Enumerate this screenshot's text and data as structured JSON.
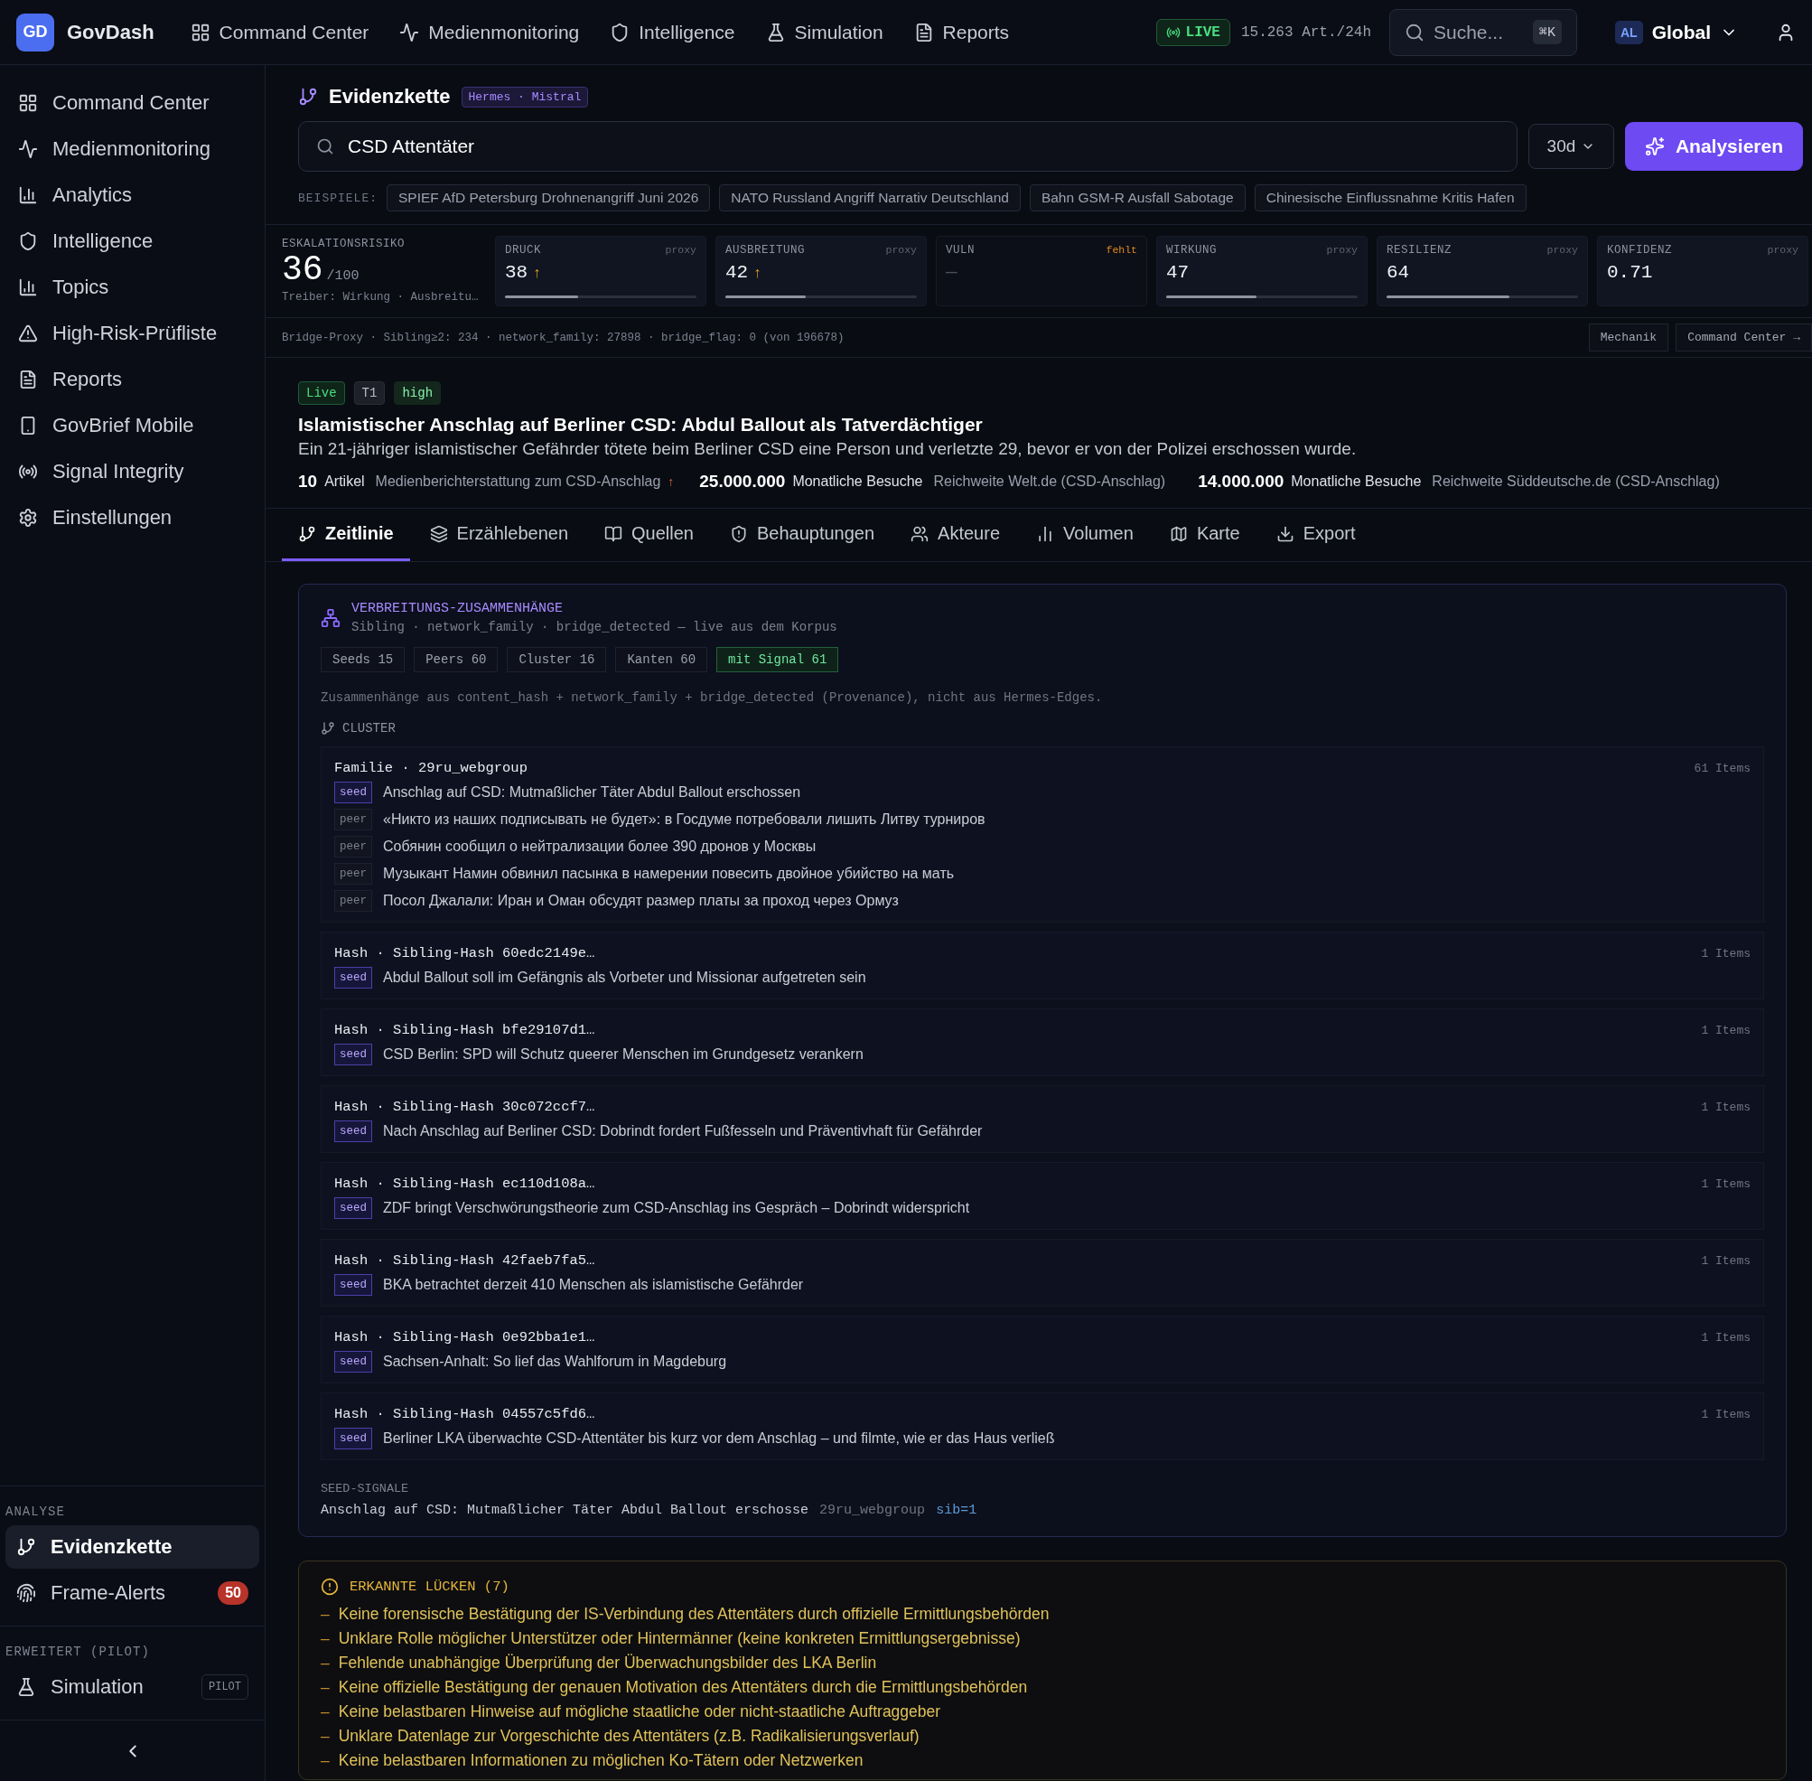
{
  "topbar": {
    "logo_badge": "GD",
    "logo_text": "GovDash",
    "nav": [
      {
        "label": "Command Center"
      },
      {
        "label": "Medienmonitoring"
      },
      {
        "label": "Intelligence"
      },
      {
        "label": "Simulation"
      },
      {
        "label": "Reports"
      }
    ],
    "live": "LIVE",
    "rate": "15.263 Art./24h",
    "search_placeholder": "Suche...",
    "search_shortcut": "⌘K",
    "scope_badge": "AL",
    "scope": "Global"
  },
  "sidebar": {
    "items": [
      {
        "label": "Command Center",
        "selected": false
      },
      {
        "label": "Medienmonitoring",
        "selected": false
      },
      {
        "label": "Analytics",
        "selected": false
      },
      {
        "label": "Intelligence",
        "selected": false
      },
      {
        "label": "Topics",
        "selected": false
      },
      {
        "label": "High-Risk-Prüfliste",
        "selected": false
      },
      {
        "label": "Reports",
        "selected": false
      },
      {
        "label": "GovBrief Mobile",
        "selected": false
      },
      {
        "label": "Signal Integrity",
        "selected": false
      },
      {
        "label": "Einstellungen",
        "selected": false
      }
    ],
    "sections": [
      {
        "title": "ANALYSE",
        "items": [
          {
            "label": "Evidenzkette",
            "selected": true
          },
          {
            "label": "Frame-Alerts",
            "selected": false,
            "badge": "50"
          }
        ]
      },
      {
        "title": "ERWEITERT (PILOT)",
        "items": [
          {
            "label": "Simulation",
            "selected": false,
            "tag": "PILOT"
          }
        ]
      }
    ]
  },
  "header": {
    "title": "Evidenzkette",
    "model_tag": "Hermes · Mistral",
    "query": "CSD Attentäter",
    "period": "30d",
    "analyze_button": "Analysieren",
    "examples_label": "BEISPIELE:",
    "examples": [
      "SPIEF AfD Petersburg Drohnenangriff Juni 2026",
      "NATO Russland Angriff Narrativ Deutschland",
      "Bahn GSM-R Ausfall Sabotage",
      "Chinesische Einflussnahme Kritis Hafen"
    ]
  },
  "escalation": {
    "label": "ESKALATIONSRISIKO",
    "value": "36",
    "scale": "/100",
    "drivers": "Treiber: Wirkung · Ausbreitu…"
  },
  "metrics": [
    {
      "label": "DRUCK",
      "tag": "proxy",
      "missing": false,
      "value": "38",
      "trend": "↑",
      "level": 0.38
    },
    {
      "label": "AUSBREITUNG",
      "tag": "proxy",
      "missing": false,
      "value": "42",
      "trend": "↑",
      "level": 0.42
    },
    {
      "label": "VULN",
      "tag": "fehlt",
      "missing": true,
      "value": "—"
    },
    {
      "label": "WIRKUNG",
      "tag": "proxy",
      "missing": false,
      "value": "47",
      "level": 0.47
    },
    {
      "label": "RESILIENZ",
      "tag": "proxy",
      "missing": false,
      "value": "64",
      "level": 0.64
    },
    {
      "label": "KONFIDENZ",
      "tag": "proxy",
      "missing": false,
      "value": "0.71"
    }
  ],
  "proxy_line": "Bridge-Proxy · Sibling≥2: 234 · network_family: 27898 · bridge_flag: 0 (von 196678)",
  "proxy_buttons": [
    "Mechanik",
    "Command Center →"
  ],
  "story": {
    "badges": [
      {
        "label": "Live",
        "kind": "live"
      },
      {
        "label": "T1",
        "kind": "tier"
      },
      {
        "label": "high",
        "kind": "level"
      }
    ],
    "title": "Islamistischer Anschlag auf Berliner CSD: Abdul Ballout als Tatverdächtiger",
    "summary": "Ein 21-jähriger islamistischer Gefährder tötete beim Berliner CSD eine Person und verletzte 29, bevor er von der Polizei erschossen wurde.",
    "stats": [
      {
        "value": "10",
        "unit": "Artikel",
        "desc": "Medienberichterstattung zum CSD-Anschlag",
        "trend": "↑"
      },
      {
        "value": "25.000.000",
        "unit": "Monatliche Besuche",
        "desc": "Reichweite Welt.de (CSD-Anschlag)"
      },
      {
        "value": "14.000.000",
        "unit": "Monatliche Besuche",
        "desc": "Reichweite Süddeutsche.de (CSD-Anschlag)"
      }
    ]
  },
  "tabs": [
    {
      "label": "Zeitlinie",
      "selected": true
    },
    {
      "label": "Erzählebenen",
      "selected": false
    },
    {
      "label": "Quellen",
      "selected": false
    },
    {
      "label": "Behauptungen",
      "selected": false
    },
    {
      "label": "Akteure",
      "selected": false
    },
    {
      "label": "Volumen",
      "selected": false
    },
    {
      "label": "Karte",
      "selected": false
    },
    {
      "label": "Export",
      "selected": false
    }
  ],
  "spread": {
    "title": "VERBREITUNGS-ZUSAMMENHÄNGE",
    "subtitle": "Sibling · network_family · bridge_detected — live aus dem Korpus",
    "chips": [
      {
        "label": "Seeds 15",
        "highlighted": false
      },
      {
        "label": "Peers 60",
        "highlighted": false
      },
      {
        "label": "Cluster 16",
        "highlighted": false
      },
      {
        "label": "Kanten 60",
        "highlighted": false
      },
      {
        "label": "mit Signal 61",
        "highlighted": true
      }
    ],
    "note": "Zusammenhänge aus content_hash + network_family + bridge_detected (Provenance), nicht aus Hermes-Edges.",
    "cluster_label": "CLUSTER",
    "clusters": [
      {
        "title": "Familie · 29ru_webgroup",
        "count": "61 Items",
        "items": [
          {
            "role": "seed",
            "highlighted": true,
            "text": "Anschlag auf CSD: Mutmaßlicher Täter Abdul Ballout erschossen"
          },
          {
            "role": "peer",
            "highlighted": false,
            "text": "«Никто из наших подписывать не будет»: в Госдуме потребовали лишить Литву турниров"
          },
          {
            "role": "peer",
            "highlighted": false,
            "text": "Собянин сообщил о нейтрализации более 390 дронов у Москвы"
          },
          {
            "role": "peer",
            "highlighted": false,
            "text": "Музыкант Намин обвинил пасынка в намерении повесить двойное убийство на мать"
          },
          {
            "role": "peer",
            "highlighted": false,
            "text": "Посол Джалали: Иран и Оман обсудят размер платы за проход через Ормуз"
          }
        ]
      },
      {
        "title": "Hash · Sibling-Hash 60edc2149e…",
        "count": "1 Items",
        "items": [
          {
            "role": "seed",
            "highlighted": true,
            "text": "Abdul Ballout soll im Gefängnis als Vorbeter und Missionar aufgetreten sein"
          }
        ]
      },
      {
        "title": "Hash · Sibling-Hash bfe29107d1…",
        "count": "1 Items",
        "items": [
          {
            "role": "seed",
            "highlighted": true,
            "text": "CSD Berlin: SPD will Schutz queerer Menschen im Grundgesetz verankern"
          }
        ]
      },
      {
        "title": "Hash · Sibling-Hash 30c072ccf7…",
        "count": "1 Items",
        "items": [
          {
            "role": "seed",
            "highlighted": true,
            "text": "Nach Anschlag auf Berliner CSD: Dobrindt fordert Fußfesseln und Präventivhaft für Gefährder"
          }
        ]
      },
      {
        "title": "Hash · Sibling-Hash ec110d108a…",
        "count": "1 Items",
        "items": [
          {
            "role": "seed",
            "highlighted": true,
            "text": "ZDF bringt Verschwörungstheorie zum CSD-Anschlag ins Gespräch – Dobrindt widerspricht"
          }
        ]
      },
      {
        "title": "Hash · Sibling-Hash 42faeb7fa5…",
        "count": "1 Items",
        "items": [
          {
            "role": "seed",
            "highlighted": true,
            "text": "BKA betrachtet derzeit 410 Menschen als islamistische Gefährder"
          }
        ]
      },
      {
        "title": "Hash · Sibling-Hash 0e92bba1e1…",
        "count": "1 Items",
        "items": [
          {
            "role": "seed",
            "highlighted": true,
            "text": "Sachsen-Anhalt: So lief das Wahlforum in Magdeburg"
          }
        ]
      },
      {
        "title": "Hash · Sibling-Hash 04557c5fd6…",
        "count": "1 Items",
        "items": [
          {
            "role": "seed",
            "highlighted": true,
            "text": "Berliner LKA überwachte CSD-Attentäter bis kurz vor dem Anschlag – und filmte, wie er das Haus verließ"
          }
        ]
      }
    ],
    "seed_signals_label": "SEED-SIGNALE",
    "seed_signal": {
      "text": "Anschlag auf CSD: Mutmaßlicher Täter Abdul Ballout erschosse",
      "source": "29ru_webgroup",
      "sib": "sib=1"
    }
  },
  "gaps": {
    "title": "ERKANNTE LÜCKEN (7)",
    "bullet": "–",
    "items": [
      "Keine forensische Bestätigung der IS-Verbindung des Attentäters durch offizielle Ermittlungsbehörden",
      "Unklare Rolle möglicher Unterstützer oder Hintermänner (keine konkreten Ermittlungsergebnisse)",
      "Fehlende unabhängige Überprüfung der Überwachungsbilder des LKA Berlin",
      "Keine offizielle Bestätigung der genauen Motivation des Attentäters durch die Ermittlungsbehörden",
      "Keine belastbaren Hinweise auf mögliche staatliche oder nicht-staatliche Auftraggeber",
      "Unklare Datenlage zur Vorgeschichte des Attentäters (z.B. Radikalisierungsverlauf)",
      "Keine belastbaren Informationen zu möglichen Ko-Tätern oder Netzwerken"
    ]
  }
}
